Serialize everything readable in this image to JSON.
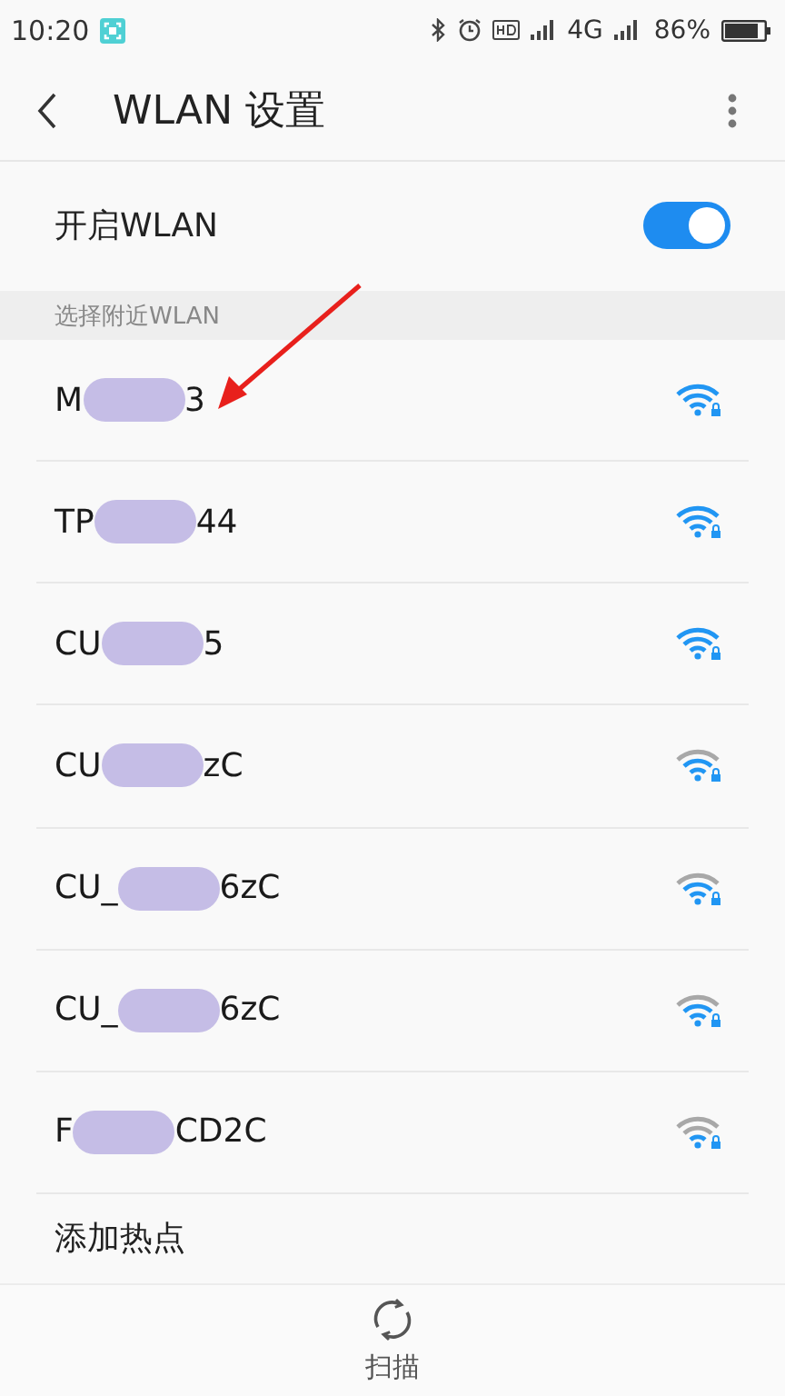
{
  "status_bar": {
    "time": "10:20",
    "battery": "86%",
    "network": "4G"
  },
  "header": {
    "title": "WLAN 设置"
  },
  "wlan_toggle": {
    "label": "开启WLAN",
    "on": true
  },
  "section_label": "选择附近WLAN",
  "networks": [
    {
      "name_start": "M",
      "name_end": "3",
      "kind": "full",
      "locked": true
    },
    {
      "name_start": "TP",
      "name_end": "44",
      "kind": "full",
      "locked": true
    },
    {
      "name_start": "CU",
      "name_end": "5",
      "kind": "full",
      "locked": true
    },
    {
      "name_start": "CU",
      "name_end": "zC",
      "kind": "good",
      "locked": true
    },
    {
      "name_start": "CU_",
      "name_end": "6zC",
      "kind": "good",
      "locked": true
    },
    {
      "name_start": "CU_",
      "name_end": "6zC",
      "kind": "good",
      "locked": true
    },
    {
      "name_start": "F",
      "name_end": "CD2C",
      "kind": "fair",
      "locked": true
    }
  ],
  "add_hotspot": "添加热点",
  "bottom_bar": {
    "scan_label": "扫描"
  }
}
